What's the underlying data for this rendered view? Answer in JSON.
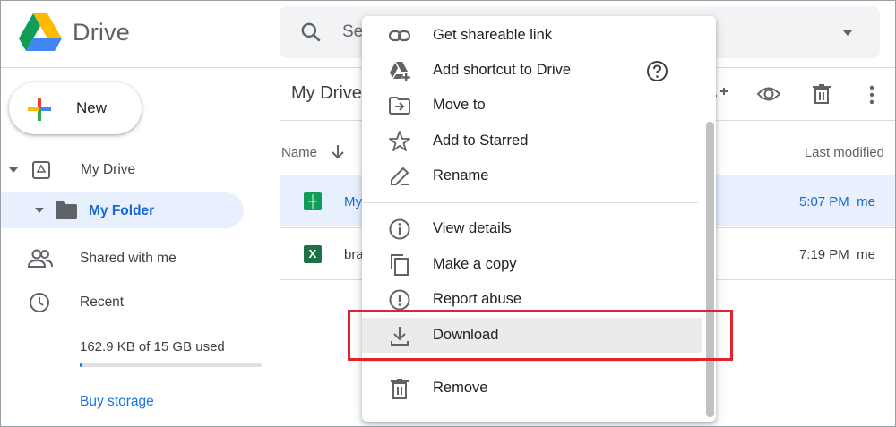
{
  "app": {
    "title": "Drive"
  },
  "search": {
    "placeholder": "Se"
  },
  "sidebar": {
    "new_label": "New",
    "items": [
      {
        "label": "My Drive"
      },
      {
        "label": "My Folder"
      },
      {
        "label": "Shared with me"
      },
      {
        "label": "Recent"
      }
    ],
    "storage_text": "162.9 KB of 15 GB used",
    "storage_fraction": 1e-05,
    "buy_storage": "Buy storage"
  },
  "main": {
    "title": "My Drive",
    "columns": {
      "name": "Name",
      "modified": "Last modified"
    },
    "files": [
      {
        "name": "My",
        "modified": "5:07 PM",
        "owner": "me",
        "type": "sheets",
        "selected": true
      },
      {
        "name": "bra",
        "modified": "7:19 PM",
        "owner": "me",
        "type": "excel",
        "selected": false
      }
    ]
  },
  "menu": {
    "items": [
      {
        "label": "Get shareable link",
        "icon": "link-icon"
      },
      {
        "label": "Add shortcut to Drive",
        "icon": "drive-shortcut-icon"
      },
      {
        "label": "Move to",
        "icon": "move-to-icon"
      },
      {
        "label": "Add to Starred",
        "icon": "star-icon"
      },
      {
        "label": "Rename",
        "icon": "pencil-icon"
      },
      {
        "label": "View details",
        "icon": "info-icon"
      },
      {
        "label": "Make a copy",
        "icon": "copy-icon"
      },
      {
        "label": "Report abuse",
        "icon": "report-icon"
      },
      {
        "label": "Download",
        "icon": "download-icon"
      },
      {
        "label": "Remove",
        "icon": "trash-icon"
      }
    ],
    "highlighted": "Download"
  },
  "colors": {
    "accent": "#1a73e8",
    "selected_bg": "#e8f0fe",
    "highlight_box": "#e0232e",
    "sheets_green": "#0f9d58",
    "excel_green": "#1e7145"
  }
}
